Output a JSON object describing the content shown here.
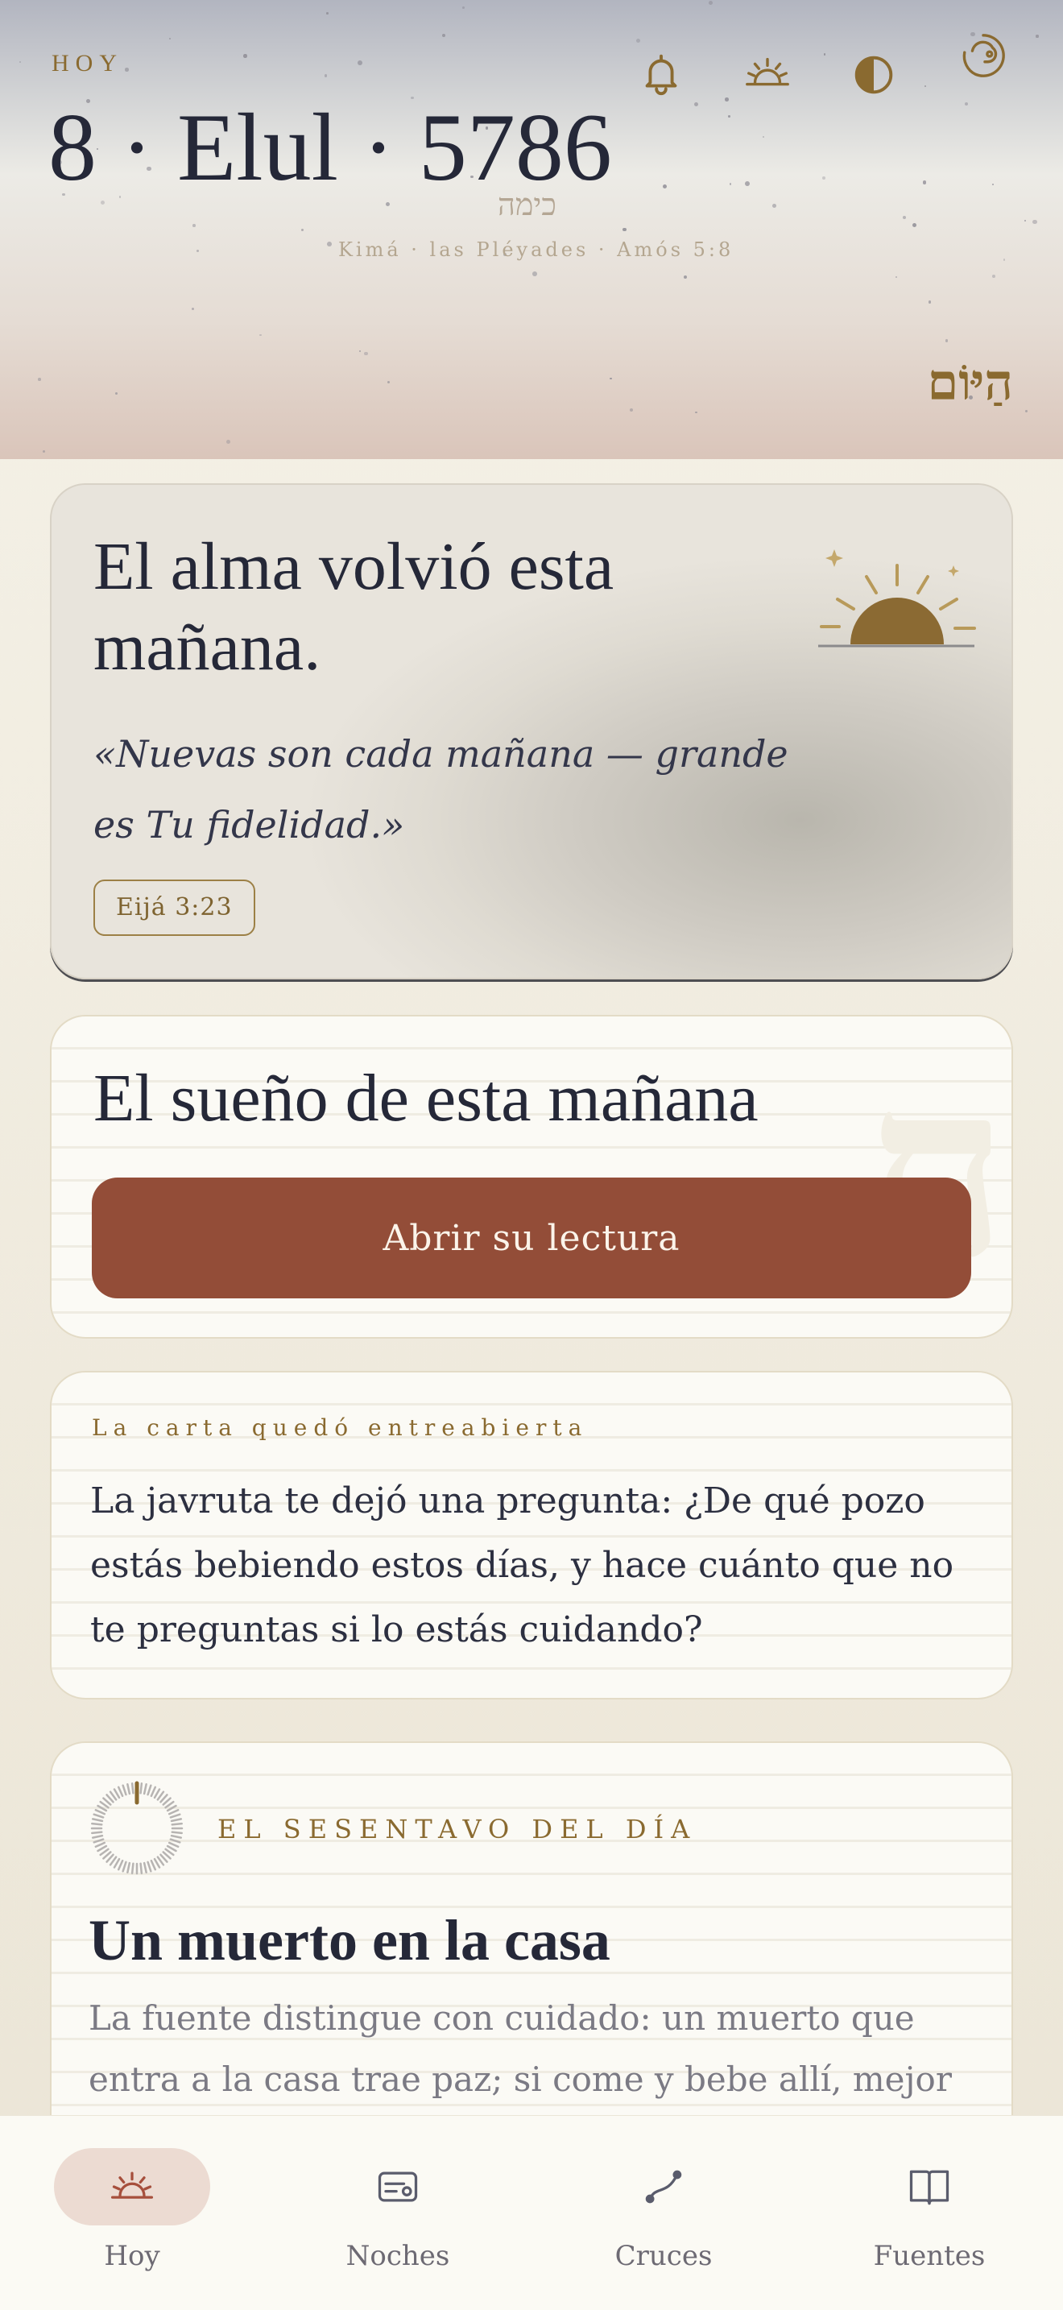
{
  "header": {
    "today_label": "HOY",
    "date": "8 · Elul · 5786",
    "kima_hebrew": "כימה",
    "kima_caption": "Kimá · las Pléyades · Amós 5:8",
    "hayom_hebrew": "הַיּוֹם",
    "icons": [
      "bell-icon",
      "sunrise-icon",
      "moon-phase-icon",
      "profile-icon"
    ]
  },
  "morning_card": {
    "title": "El alma volvió esta mañana.",
    "quote": "«Nuevas son cada mañana — grande es Tu fidelidad.»",
    "reference": "Eijá 3:23",
    "icon": "sunrise-icon"
  },
  "dream_card": {
    "title": "El sueño de esta mañana",
    "button_label": "Abrir su lectura",
    "watermark": "ח"
  },
  "letter_card": {
    "eyebrow": "La carta quedó entreabierta",
    "body": "La javruta te dejó una pregunta: ¿De qué pozo estás bebiendo estos días, y hace cuánto que no te preguntas si lo estás cuidando?"
  },
  "sixtieth_card": {
    "eyebrow": "EL SESENTAVO DEL DÍA",
    "title": "Un muerto en la casa",
    "body": "La fuente distingue con cuidado: un muerto que entra a la casa trae paz; si come y bebe allí, mejor",
    "progress_fraction": 0.02
  },
  "colors": {
    "accent_gold": "#8a6a30",
    "button_brick": "#934d38",
    "ink": "#252838"
  },
  "nav": {
    "items": [
      {
        "label": "Hoy",
        "icon": "sunrise-icon",
        "active": true
      },
      {
        "label": "Noches",
        "icon": "card-icon",
        "active": false
      },
      {
        "label": "Cruces",
        "icon": "path-icon",
        "active": false
      },
      {
        "label": "Fuentes",
        "icon": "book-icon",
        "active": false
      }
    ]
  }
}
